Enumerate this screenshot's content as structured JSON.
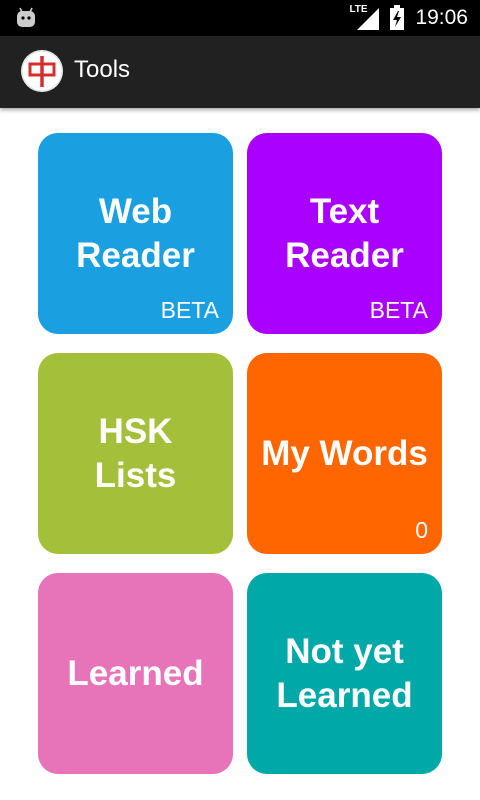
{
  "status_bar": {
    "network": "LTE",
    "time": "19:06"
  },
  "app_bar": {
    "logo_char": "中",
    "title": "Tools"
  },
  "colors": {
    "web_reader": "#1a9fe0",
    "text_reader": "#aa00ff",
    "hsk_lists": "#a4c03a",
    "my_words": "#ff6600",
    "learned": "#e773b8",
    "not_yet_learned": "#00a8a8"
  },
  "tiles": {
    "web_reader": {
      "line1": "Web",
      "line2": "Reader",
      "badge": "BETA"
    },
    "text_reader": {
      "line1": "Text",
      "line2": "Reader",
      "badge": "BETA"
    },
    "hsk_lists": {
      "line1": "HSK",
      "line2": "Lists"
    },
    "my_words": {
      "line1": "My Words",
      "badge": "0"
    },
    "learned": {
      "line1": "Learned"
    },
    "not_yet_learned": {
      "line1": "Not yet",
      "line2": "Learned"
    }
  },
  "icons": [
    "android-icon",
    "signal-icon",
    "battery-charging-icon",
    "app-logo-icon"
  ]
}
